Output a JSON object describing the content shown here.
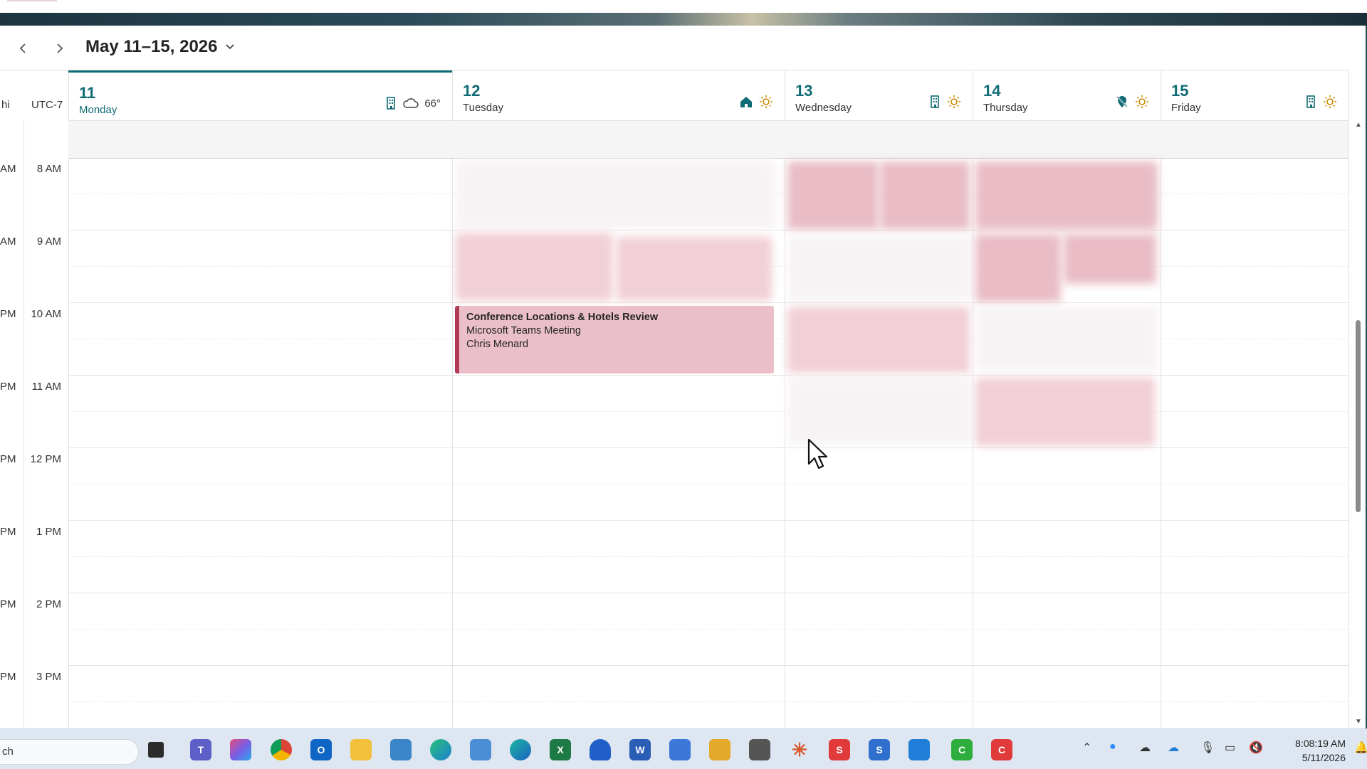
{
  "toolbar": {
    "prev_icon": "chevron-left-icon",
    "next_icon": "chevron-right-icon",
    "date_range": "May 11–15, 2026",
    "date_range_chevron": "chevron-down-icon"
  },
  "timezones": {
    "secondary_cut": "hi",
    "primary": "UTC-7"
  },
  "days": [
    {
      "num": "11",
      "name": "Monday",
      "location_icon": "office-building-icon",
      "weather_icon": "cloud-icon",
      "temp": "66°",
      "today": true
    },
    {
      "num": "12",
      "name": "Tuesday",
      "location_icon": "home-icon",
      "weather_icon": "sun-icon"
    },
    {
      "num": "13",
      "name": "Wednesday",
      "location_icon": "office-building-icon",
      "weather_icon": "sun-icon"
    },
    {
      "num": "14",
      "name": "Thursday",
      "location_icon": "location-off-icon",
      "weather_icon": "sun-icon"
    },
    {
      "num": "15",
      "name": "Friday",
      "location_icon": "office-building-icon",
      "weather_icon": "sun-icon"
    }
  ],
  "times": [
    "8 AM",
    "9 AM",
    "10 AM",
    "11 AM",
    "12 PM",
    "1 PM",
    "2 PM",
    "3 PM"
  ],
  "secondary_times": [
    "AM",
    "AM",
    "PM",
    "PM",
    "PM",
    "PM",
    "PM",
    "PM"
  ],
  "event": {
    "title": "Conference Locations & Hotels Review",
    "line1": "Microsoft Teams Meeting",
    "line2": "Chris Menard"
  },
  "taskbar": {
    "search_text": "ch",
    "clock_time": "8:08:19 AM",
    "clock_date": "5/11/2026",
    "apps": [
      "teams-icon",
      "m365-icon",
      "chrome-icon",
      "outlook-icon",
      "file-explorer-icon",
      "network-icon",
      "edge-icon",
      "notepad-icon",
      "edge-dev-icon",
      "excel-icon",
      "arc-icon",
      "word-icon",
      "app-icon",
      "document-icon",
      "printer-icon",
      "claude-icon",
      "snagit-icon",
      "skype-icon",
      "paint-icon",
      "camtasia-icon",
      "camtasia-recorder-icon"
    ]
  },
  "colors": {
    "accent": "#0f6b74",
    "event_fill": "#ebbfc9",
    "event_border": "#b33a54"
  }
}
